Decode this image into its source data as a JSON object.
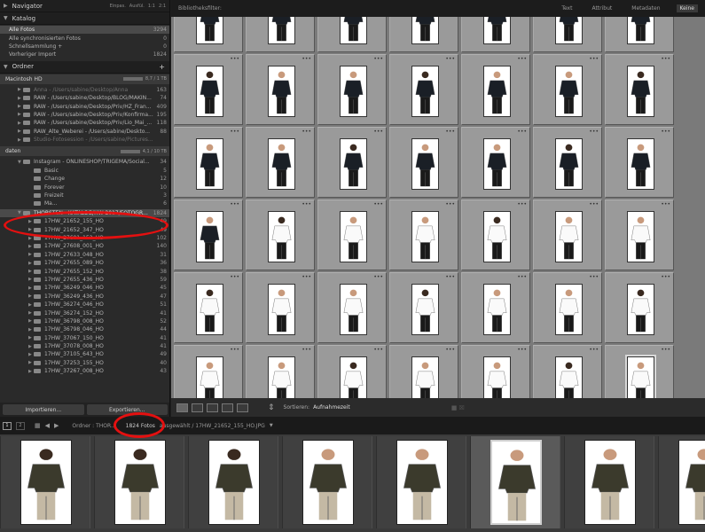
{
  "navigator": {
    "title": "Navigator",
    "options": [
      "Einpas.",
      "Ausfül.",
      "1:1",
      "2:1"
    ]
  },
  "catalog": {
    "title": "Katalog",
    "items": [
      {
        "label": "Alle Fotos",
        "count": "3294",
        "hl": true
      },
      {
        "label": "Alle synchronisierten Fotos",
        "count": "0"
      },
      {
        "label": "Schnellsammlung +",
        "count": "0"
      },
      {
        "label": "Vorheriger Import",
        "count": "1824"
      }
    ]
  },
  "folders": {
    "title": "Ordner",
    "add": "+",
    "volume1": {
      "name": "Macintosh HD",
      "size": "8,7 / 1 TB"
    },
    "items1": [
      {
        "label": "Anna - /Users/sabine/Desktop/Anna",
        "count": "163",
        "dim": true
      },
      {
        "label": "RAW - /Users/sabine/Desktop/BLOG/MAKIN...",
        "count": "74"
      },
      {
        "label": "RAW - /Users/sabine/Desktop/Priv/HZ_Fran...",
        "count": "409"
      },
      {
        "label": "RAW - /Users/sabine/Desktop/Priv/Konfirma...",
        "count": "195"
      },
      {
        "label": "RAW - /Users/sabine/Desktop/Priv/Lio_Mai_...",
        "count": "118"
      },
      {
        "label": "RAW_Alte_Weberei - /Users/sabine/Deskto...",
        "count": "88"
      },
      {
        "label": "Studio-Fotosession - /Users/sabine/Pictures...",
        "count": "",
        "dim": true
      }
    ],
    "volume2": {
      "name": "daten",
      "size": "4,1 / 10 TB"
    },
    "items2": [
      {
        "label": "Instagram - ONLINESHOP/TRIGEMA/Social...",
        "count": "34",
        "exp": true
      },
      {
        "label": "Basic",
        "count": "5",
        "indent": true
      },
      {
        "label": "Change",
        "count": "12",
        "indent": true
      },
      {
        "label": "Forever",
        "count": "10",
        "indent": true
      },
      {
        "label": "Freizeit",
        "count": "3",
        "indent": true
      },
      {
        "label": "Ma...",
        "count": "6",
        "indent": true
      }
    ],
    "selected": {
      "label": "THORSTEN - KATALOG/HW 2017/FOTOGRA...",
      "count": "1824"
    },
    "sub": [
      {
        "label": "17HW_21652_155_HO",
        "count": "49"
      },
      {
        "label": "17HW_21652_347_HO",
        "count": "49"
      },
      {
        "label": "17HW_27601_152_HO",
        "count": "102"
      },
      {
        "label": "17HW_27608_001_HO",
        "count": "140"
      },
      {
        "label": "17HW_27633_048_HO",
        "count": "31"
      },
      {
        "label": "17HW_27655_089_HO",
        "count": "36"
      },
      {
        "label": "17HW_27655_152_HO",
        "count": "38"
      },
      {
        "label": "17HW_27655_436_HO",
        "count": "59"
      },
      {
        "label": "17HW_36249_046_HO",
        "count": "45"
      },
      {
        "label": "17HW_36249_436_HO",
        "count": "47"
      },
      {
        "label": "17HW_36274_046_HO",
        "count": "51"
      },
      {
        "label": "17HW_36274_152_HO",
        "count": "41"
      },
      {
        "label": "17HW_36798_008_HO",
        "count": "52"
      },
      {
        "label": "17HW_36798_046_HO",
        "count": "44"
      },
      {
        "label": "17HW_37067_150_HO",
        "count": "41"
      },
      {
        "label": "17HW_37078_008_HO",
        "count": "41"
      },
      {
        "label": "17HW_37105_643_HO",
        "count": "49"
      },
      {
        "label": "17HW_37253_155_HO",
        "count": "40"
      },
      {
        "label": "17HW_37267_008_HO",
        "count": "43"
      }
    ]
  },
  "left_buttons": {
    "import": "Importieren...",
    "export": "Exportieren..."
  },
  "filter": {
    "title": "Bibliotheksfilter:",
    "tabs": [
      "Text",
      "Attribut",
      "Metadaten",
      "Keine"
    ],
    "active": "Keine"
  },
  "toolbar": {
    "sort_label": "Sortieren:",
    "sort_value": "Aufnahmezeit"
  },
  "status": {
    "page1": "1",
    "page2": "2",
    "ordner": "Ordner : THOR...",
    "count": "1824 Fotos",
    "selected": "ausgewählt / 17HW_21652_155_HO.JPG"
  },
  "grid": {
    "rows": [
      [
        "d",
        "d",
        "d",
        "d",
        "d",
        "d",
        "d"
      ],
      [
        "d",
        "d",
        "d",
        "d",
        "d",
        "d",
        "d"
      ],
      [
        "d",
        "d",
        "d",
        "d",
        "d",
        "d",
        "d"
      ],
      [
        "d",
        "w",
        "w",
        "w",
        "w",
        "w",
        "w"
      ],
      [
        "w",
        "w",
        "w",
        "w",
        "w",
        "w",
        "w"
      ],
      [
        "w",
        "w",
        "w",
        "w",
        "w",
        "w",
        "s"
      ]
    ]
  },
  "filmstrip": {
    "count": 8,
    "selected": 5
  },
  "colors": {
    "dark_shirt": "#1a1f26",
    "white_shirt": "#fafafa",
    "olive_shirt": "#3b3a2c",
    "pants": "#c4b9a4",
    "annotation": "#e41010"
  }
}
